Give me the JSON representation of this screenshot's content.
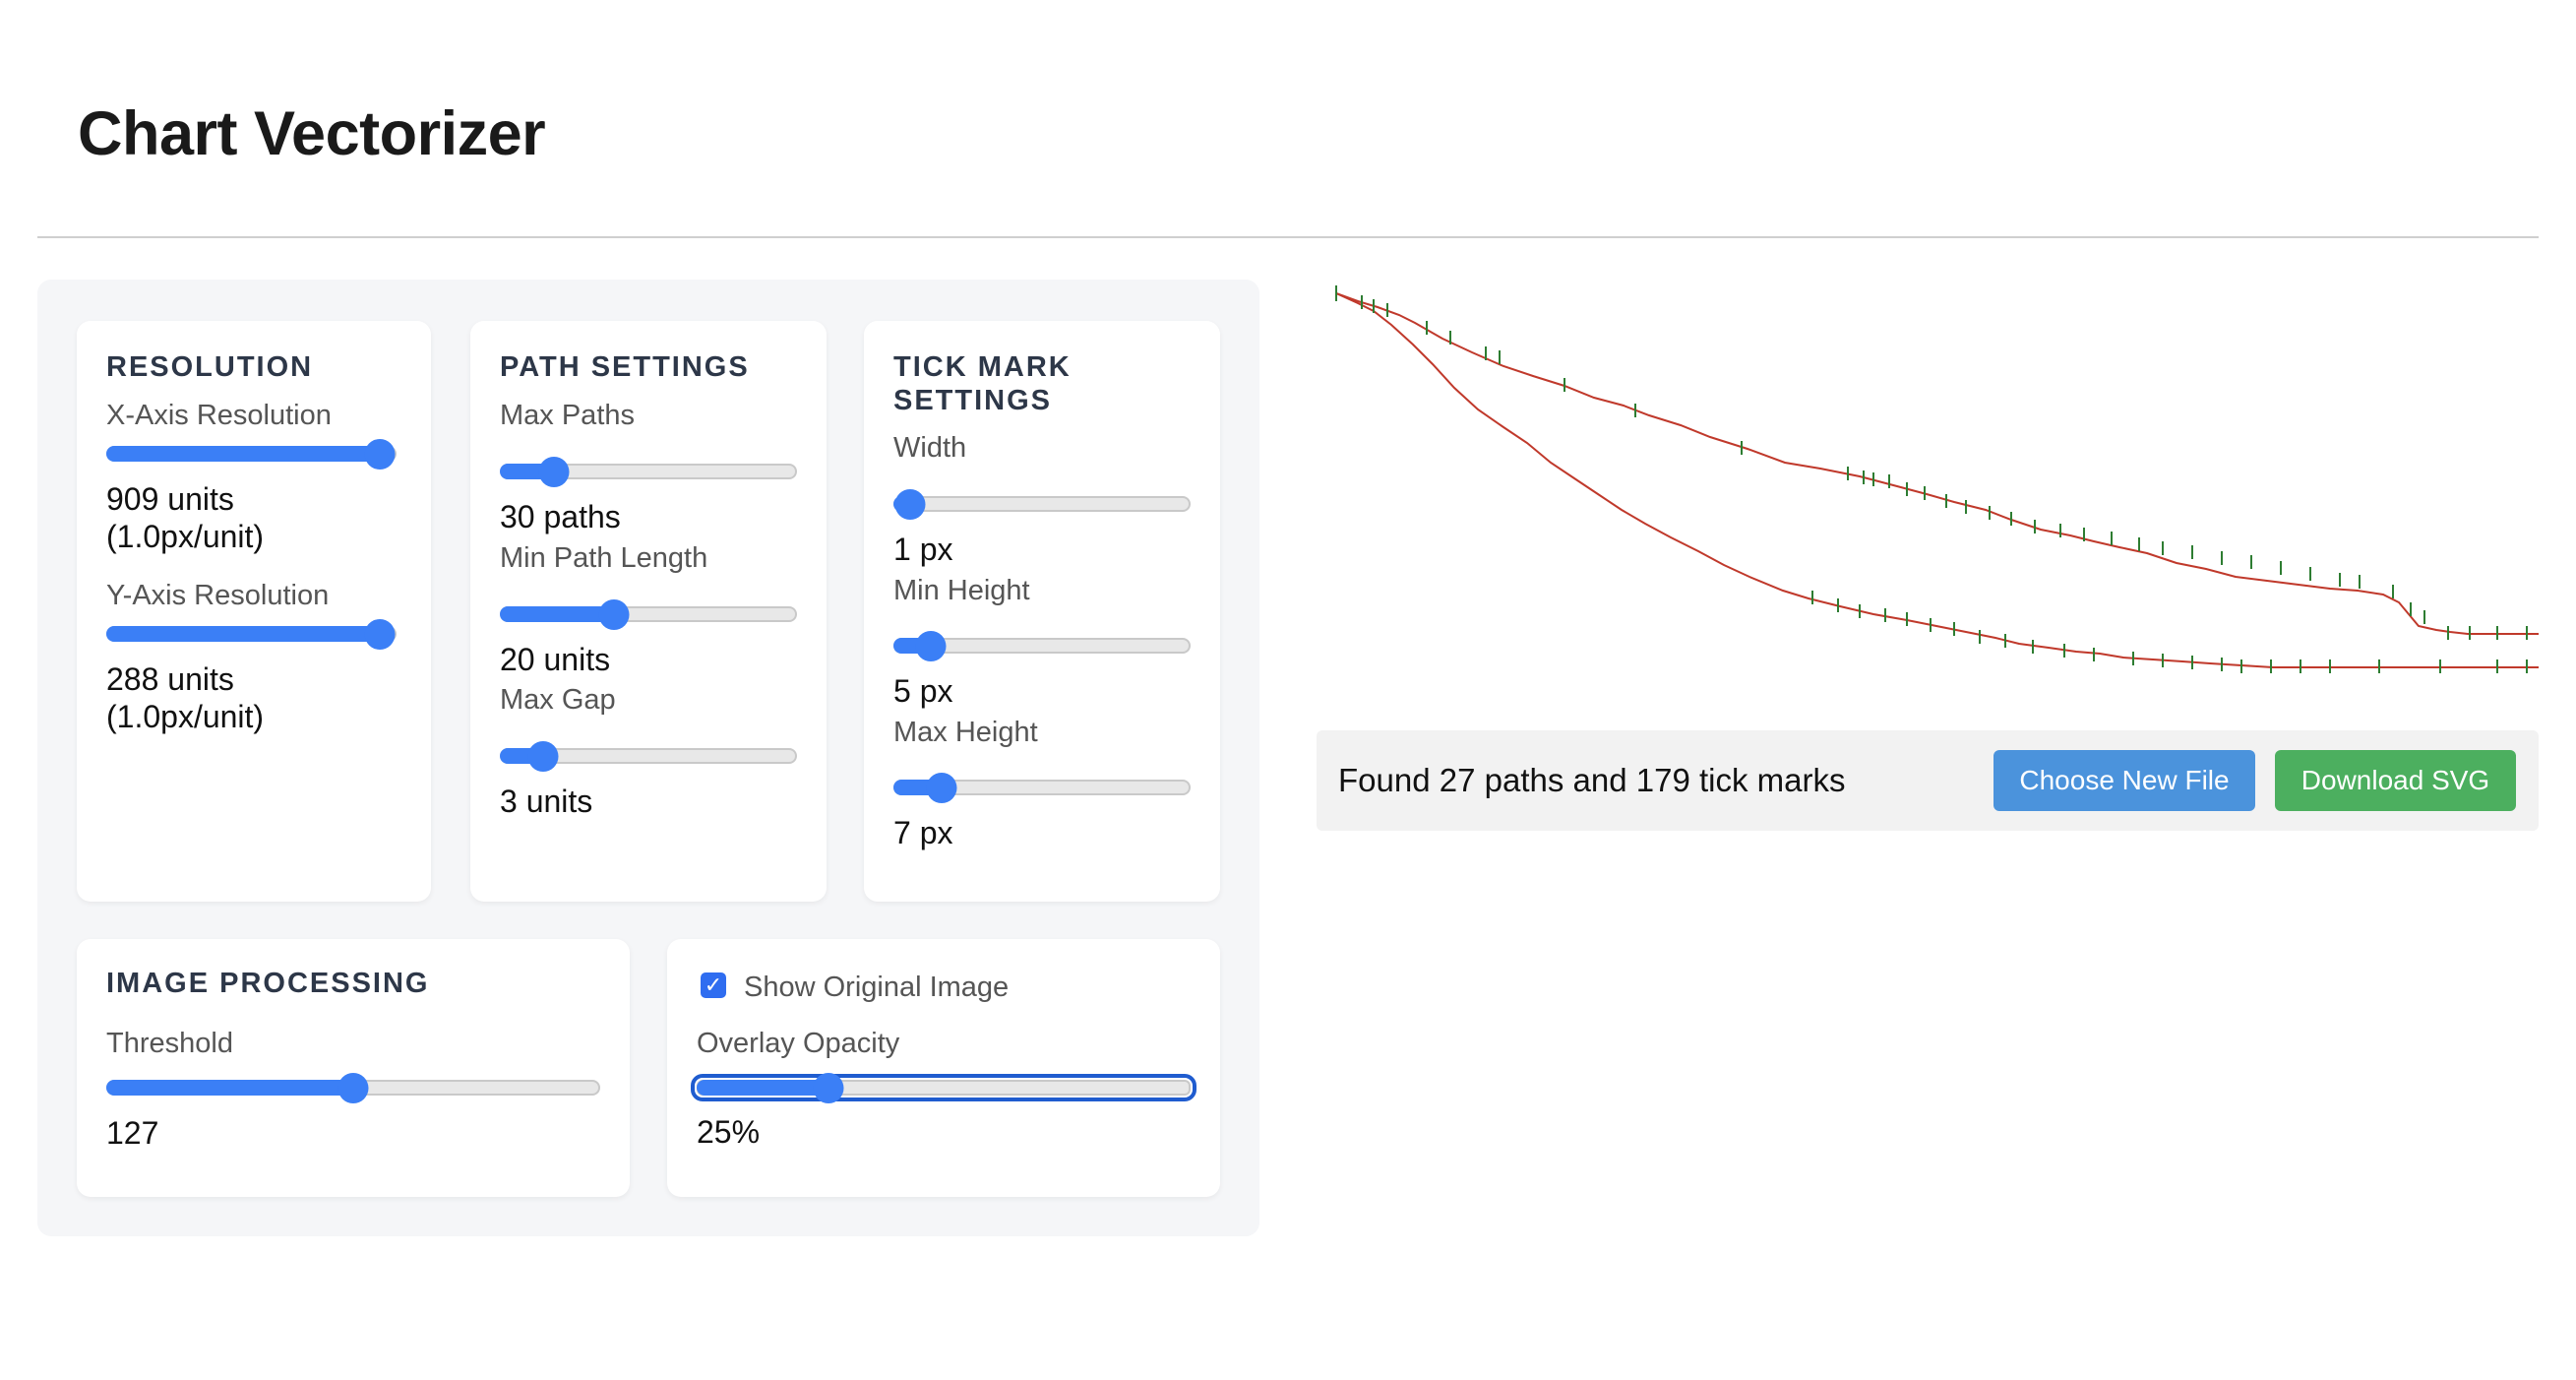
{
  "page": {
    "title": "Chart Vectorizer"
  },
  "resolution": {
    "heading": "RESOLUTION",
    "x_label": "X-Axis Resolution",
    "x_value": "909 units",
    "x_value_sub": "(1.0px/unit)",
    "x_level": 1.0,
    "y_label": "Y-Axis Resolution",
    "y_value": "288 units",
    "y_value_sub": "(1.0px/unit)",
    "y_level": 1.0
  },
  "path_settings": {
    "heading": "PATH SETTINGS",
    "max_paths_label": "Max Paths",
    "max_paths_value": "30 paths",
    "max_paths_level": 0.14,
    "min_length_label": "Min Path Length",
    "min_length_value": "20 units",
    "min_length_level": 0.37,
    "max_gap_label": "Max Gap",
    "max_gap_value": "3 units",
    "max_gap_level": 0.1
  },
  "tick_settings": {
    "heading": "TICK MARK SETTINGS",
    "width_label": "Width",
    "width_value": "1 px",
    "width_level": 0.0,
    "min_height_label": "Min Height",
    "min_height_value": "5 px",
    "min_height_level": 0.08,
    "max_height_label": "Max Height",
    "max_height_value": "7 px",
    "max_height_level": 0.12
  },
  "image_processing": {
    "heading": "IMAGE PROCESSING",
    "threshold_label": "Threshold",
    "threshold_value": "127",
    "threshold_level": 0.5
  },
  "overlay": {
    "show_original_label": "Show Original Image",
    "show_original_checked": true,
    "opacity_label": "Overlay Opacity",
    "opacity_value": "25%",
    "opacity_level": 0.25
  },
  "status": {
    "message": "Found 27 paths and 179 tick marks",
    "choose_button": "Choose New File",
    "download_button": "Download SVG"
  },
  "colors": {
    "accent": "#3b7ff6",
    "path_color": "#c0392b",
    "tick_color": "#2e7d32",
    "choose_button": "#4b93dc",
    "download_button": "#4caf5f"
  }
}
